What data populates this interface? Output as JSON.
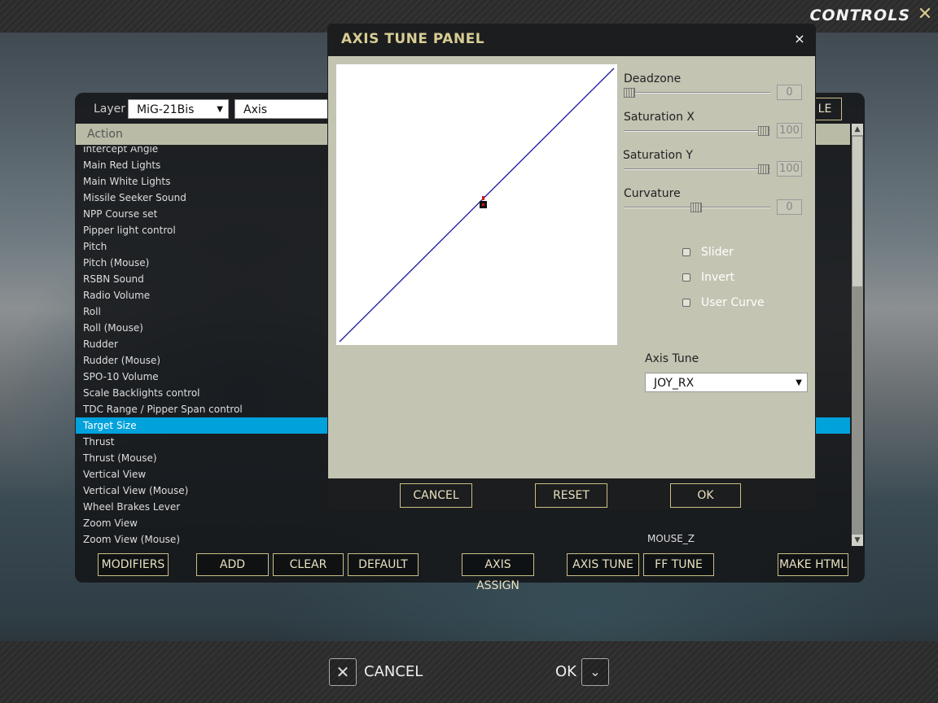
{
  "window": {
    "title": "CONTROLS",
    "close_symbol": "✕"
  },
  "toolbar": {
    "layer_label": "Layer",
    "layer_value": "MiG-21Bis",
    "category_value": "Axis Commands",
    "partial_button": "LE"
  },
  "table": {
    "header": "Action",
    "rows": [
      "Intercept Angle",
      "Main Red Lights",
      "Main White Lights",
      "Missile Seeker Sound",
      "NPP Course set",
      "Pipper light control",
      "Pitch",
      "Pitch (Mouse)",
      "RSBN Sound",
      "Radio Volume",
      "Roll",
      "Roll (Mouse)",
      "Rudder",
      "Rudder (Mouse)",
      "SPO-10 Volume",
      "Scale Backlights control",
      "TDC Range / Pipper Span control",
      "Target Size",
      "Thrust",
      "Thrust (Mouse)",
      "Vertical View",
      "Vertical View (Mouse)",
      "Wheel Brakes Lever",
      "Zoom View",
      "Zoom View (Mouse)"
    ],
    "selected_row": "Target Size",
    "visible_binding": "MOUSE_Z"
  },
  "bottom_buttons": {
    "modifiers": "MODIFIERS",
    "add": "ADD",
    "clear": "CLEAR",
    "default": "DEFAULT",
    "axis_assign": "AXIS ASSIGN",
    "axis_tune": "AXIS TUNE",
    "ff_tune": "FF TUNE",
    "make_html": "MAKE HTML"
  },
  "footer": {
    "cancel": "CANCEL",
    "ok": "OK"
  },
  "dialog": {
    "title": "AXIS TUNE PANEL",
    "close_symbol": "×",
    "deadzone_label": "Deadzone",
    "deadzone_value": "0",
    "saturation_x_label": "Saturation X",
    "saturation_x_value": "100",
    "saturation_y_label": "Saturation Y",
    "saturation_y_value": "100",
    "curvature_label": "Curvature",
    "curvature_value": "0",
    "options": [
      {
        "label": "Slider",
        "checked": false
      },
      {
        "label": "Invert",
        "checked": false
      },
      {
        "label": "User Curve",
        "checked": false
      }
    ],
    "axis_tune_label": "Axis Tune",
    "axis_tune_value": "JOY_RX",
    "cancel": "CANCEL",
    "reset": "RESET",
    "ok": "OK",
    "curve_color": "#1a1aa0",
    "cursor_color": "#d01818"
  },
  "colors": {
    "accent": "#d8cc95",
    "selection": "#00a2dc",
    "panel": "#c3c4b2"
  }
}
